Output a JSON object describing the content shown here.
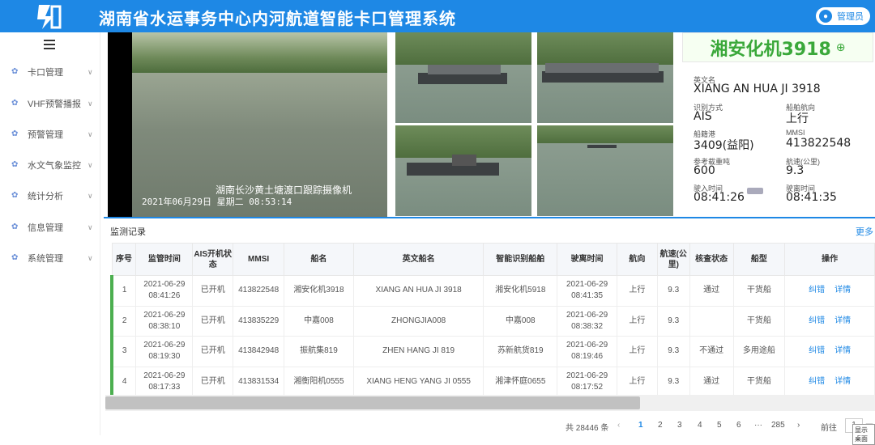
{
  "header": {
    "title": "湖南省水运事务中心内河航道智能卡口管理系统",
    "user_label": "管理员"
  },
  "sidebar": {
    "items": [
      {
        "label": "卡口管理",
        "icon": "gear-icon"
      },
      {
        "label": "VHF预警播报",
        "icon": "gear-icon"
      },
      {
        "label": "预警管理",
        "icon": "gear-icon"
      },
      {
        "label": "水文气象监控",
        "icon": "gear-icon"
      },
      {
        "label": "统计分析",
        "icon": "gear-icon"
      },
      {
        "label": "信息管理",
        "icon": "gear-icon"
      },
      {
        "label": "系统管理",
        "icon": "gear-icon"
      }
    ]
  },
  "video": {
    "camera_label": "湖南长沙黄土塘渡口跟踪摄像机",
    "timestamp": "2021年06月29日 星期二 08:53:14"
  },
  "info": {
    "plate": "湘安化机3918",
    "fields": {
      "english_name_label": "英文名",
      "english_name": "XIANG AN HUA JI 3918",
      "method_label": "识别方式",
      "method": "AIS",
      "direction_label": "船舶航向",
      "direction": "上行",
      "port_label": "船籍港",
      "port": "3409(益阳)",
      "mmsi_label": "MMSI",
      "mmsi": "413822548",
      "tonnage_label": "参考载重吨",
      "tonnage": "600",
      "speed_label": "航速(公里)",
      "speed": "9.3",
      "enter_label": "驶入时间",
      "enter": "08:41:26",
      "leave_label": "驶离时间",
      "leave": "08:41:35"
    }
  },
  "records": {
    "title": "监测记录",
    "more": "更多",
    "columns": [
      "序号",
      "监管时间",
      "AIS开机状态",
      "MMSI",
      "船名",
      "英文船名",
      "智能识别船舶",
      "驶离时间",
      "航向",
      "航速(公里)",
      "核查状态",
      "船型",
      "操作"
    ],
    "rows": [
      {
        "no": "1",
        "time1": "2021-06-29",
        "time2": "08:41:26",
        "ais": "已开机",
        "mmsi": "413822548",
        "name": "湘安化机3918",
        "en": "XIANG AN HUA JI 3918",
        "ai": "湘安化机5918",
        "leave1": "2021-06-29",
        "leave2": "08:41:35",
        "dir": "上行",
        "speed": "9.3",
        "check": "通过",
        "check_ok": true,
        "type": "干货船",
        "op1": "纠错",
        "op2": "详情"
      },
      {
        "no": "2",
        "time1": "2021-06-29",
        "time2": "08:38:10",
        "ais": "已开机",
        "mmsi": "413835229",
        "name": "中嘉008",
        "en": "ZHONGJIA008",
        "ai": "中嘉008",
        "leave1": "2021-06-29",
        "leave2": "08:38:32",
        "dir": "上行",
        "speed": "9.3",
        "check": "",
        "check_ok": true,
        "type": "干货船",
        "op1": "纠错",
        "op2": "详情"
      },
      {
        "no": "3",
        "time1": "2021-06-29",
        "time2": "08:19:30",
        "ais": "已开机",
        "mmsi": "413842948",
        "name": "振航集819",
        "en": "ZHEN HANG JI 819",
        "ai": "苏新航货819",
        "leave1": "2021-06-29",
        "leave2": "08:19:46",
        "dir": "上行",
        "speed": "9.3",
        "check": "不通过",
        "check_ok": false,
        "type": "多用途船",
        "op1": "纠错",
        "op2": "详情"
      },
      {
        "no": "4",
        "time1": "2021-06-29",
        "time2": "08:17:33",
        "ais": "已开机",
        "mmsi": "413831534",
        "name": "湘衡阳机0555",
        "en": "XIANG HENG YANG JI 0555",
        "ai": "湘津怀庭0655",
        "leave1": "2021-06-29",
        "leave2": "08:17:52",
        "dir": "上行",
        "speed": "9.3",
        "check": "通过",
        "check_ok": true,
        "type": "干货船",
        "op1": "纠错",
        "op2": "详情"
      }
    ]
  },
  "pager": {
    "total": "共 28446 条",
    "prev": "‹",
    "pages": [
      "1",
      "2",
      "3",
      "4",
      "5",
      "6",
      "···",
      "285"
    ],
    "next": "›",
    "goto_label": "前往",
    "goto_value": "1",
    "page_suffix": "页",
    "tooltip": "显示桌面"
  }
}
